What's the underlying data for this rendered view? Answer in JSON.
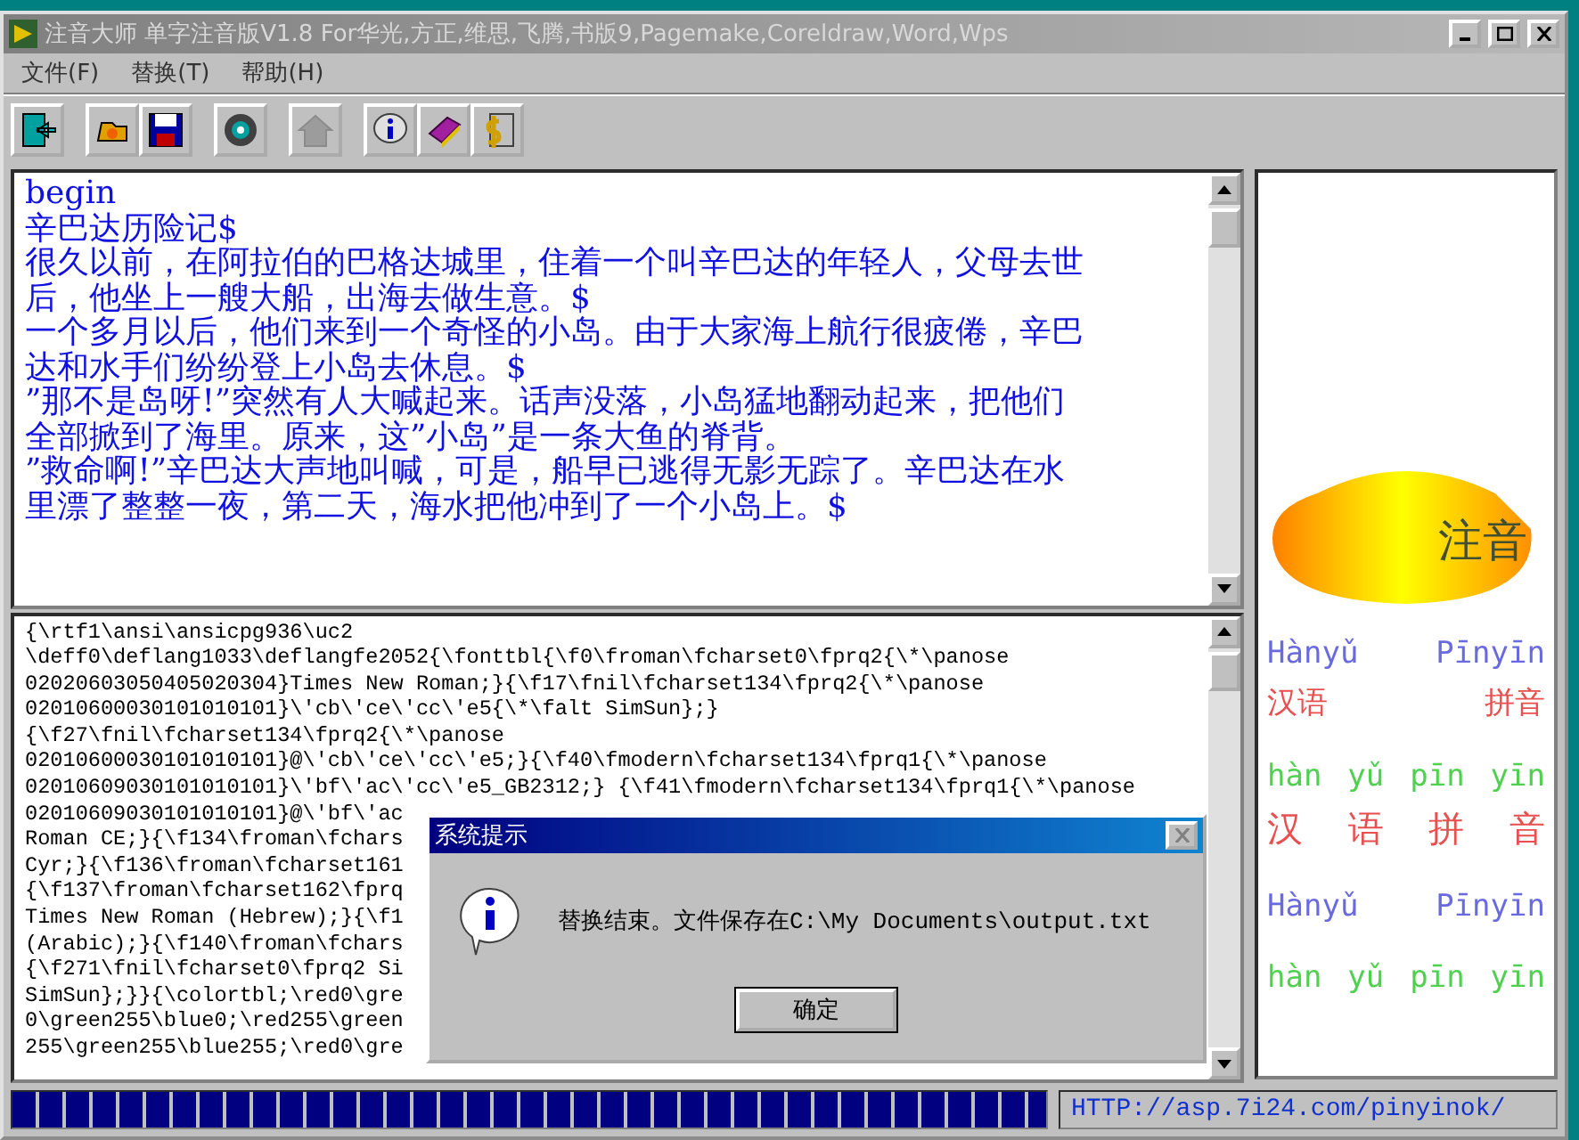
{
  "window": {
    "title": "注音大师  单字注音版V1.8 For华光,方正,维思,飞腾,书版9,Pagemake,Coreldraw,Word,Wps",
    "active": false
  },
  "menu": [
    {
      "label": "文件(F)"
    },
    {
      "label": "替换(T)"
    },
    {
      "label": "帮助(H)"
    }
  ],
  "toolbar": [
    {
      "disabled": false
    },
    {
      "disabled": false
    },
    {
      "disabled": false
    },
    {
      "disabled": false
    },
    {
      "disabled": true
    },
    {
      "disabled": false
    },
    {
      "disabled": false
    },
    {
      "disabled": false
    }
  ],
  "source_text": {
    "lines": [
      "begin",
      "辛巴达历险记$",
      "很久以前，在阿拉伯的巴格达城里，住着一个叫辛巴达的年轻人，父母去世",
      "后，他坐上一艘大船，出海去做生意。$",
      "一个多月以后，他们来到一个奇怪的小岛。由于大家海上航行很疲倦，辛巴",
      "达和水手们纷纷登上小岛去休息。$",
      "”那不是岛呀!”突然有人大喊起来。话声没落，小岛猛地翻动起来，把他们",
      "全部掀到了海里。原来，这”小岛”是一条大鱼的脊背。",
      "”救命啊!”辛巴达大声地叫喊，可是，船早已逃得无影无踪了。辛巴达在水",
      "里漂了整整一夜，第二天，海水把他冲到了一个小岛上。$"
    ]
  },
  "output_text": {
    "lines": [
      "{\\rtf1\\ansi\\ansicpg936\\uc2",
      "\\deff0\\deflang1033\\deflangfe2052{\\fonttbl{\\f0\\froman\\fcharset0\\fprq2{\\*\\panose",
      "02020603050405020304}Times New Roman;}{\\f17\\fnil\\fcharset134\\fprq2{\\*\\panose",
      "02010600030101010101}\\'cb\\'ce\\'cc\\'e5{\\*\\falt SimSun};}",
      "{\\f27\\fnil\\fcharset134\\fprq2{\\*\\panose",
      "02010600030101010101}@\\'cb\\'ce\\'cc\\'e5;}{\\f40\\fmodern\\fcharset134\\fprq1{\\*\\panose",
      "02010609030101010101}\\'bf\\'ac\\'cc\\'e5_GB2312;} {\\f41\\fmodern\\fcharset134\\fprq1{\\*\\panose",
      "02010609030101010101}@\\'bf\\'ac",
      "Roman CE;}{\\f134\\froman\\fchars",
      "Cyr;}{\\f136\\froman\\fcharset161",
      "{\\f137\\froman\\fcharset162\\fprq",
      "Times New Roman (Hebrew);}{\\f1",
      "(Arabic);}{\\f140\\froman\\fchars",
      "{\\f271\\fnil\\fcharset0\\fprq2 Si",
      "SimSun};}}{\\colortbl;\\red0\\gre",
      "0\\green255\\blue0;\\red255\\green",
      "255\\green255\\blue255;\\red0\\gre"
    ]
  },
  "preview": {
    "logo_text": "注音",
    "samples": [
      {
        "words": [
          "Hànyǔ",
          "Pīnyīn"
        ],
        "color": "#6a6ae0"
      },
      {
        "words": [
          "汉语",
          "拼音"
        ],
        "color": "#e85050"
      },
      {
        "words": [
          "hàn",
          "yǔ",
          "pīn",
          "yīn"
        ],
        "color": "#50d050"
      },
      {
        "words": [
          "汉",
          "语",
          "拼",
          "音"
        ],
        "color": "#e85050"
      },
      {
        "words": [
          "Hànyǔ",
          "Pīnyīn"
        ],
        "color": "#6a6ae0"
      },
      {
        "words": [
          "hàn",
          "yǔ",
          "pīn",
          "yīn"
        ],
        "color": "#50d050"
      }
    ]
  },
  "status_bar": {
    "progress": {
      "level": 1
    },
    "url": "HTTP://asp.7i24.com/pinyinok/"
  },
  "dialog": {
    "title": "系统提示",
    "message": "替换结束。文件保存在C:\\My Documents\\output.txt",
    "button": "确定"
  }
}
